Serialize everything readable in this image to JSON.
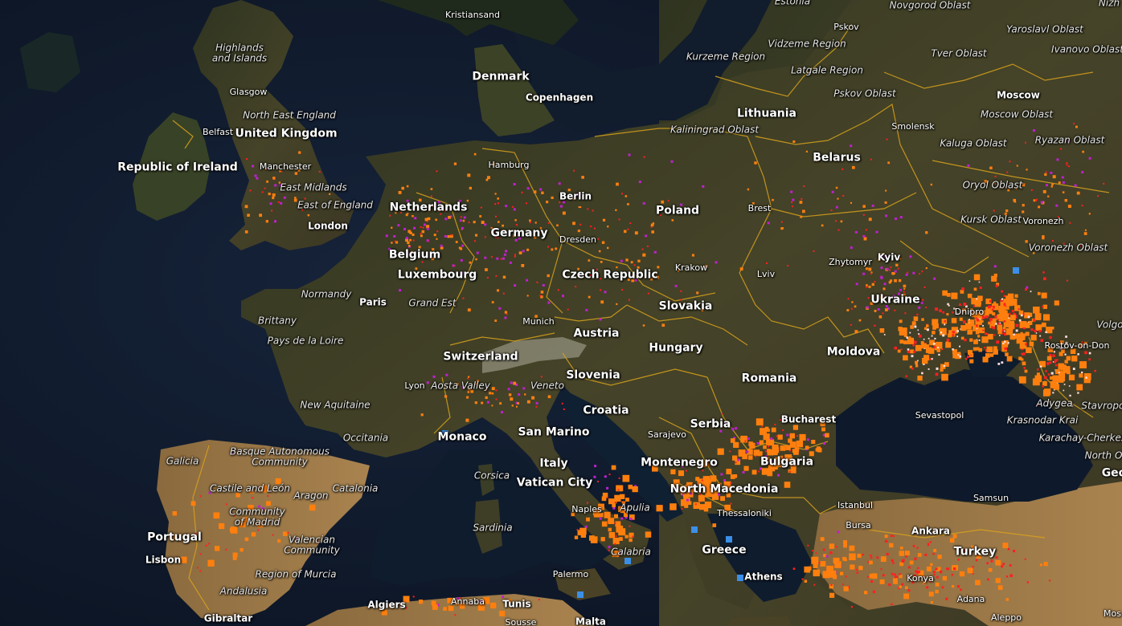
{
  "countries": [
    {
      "name": "Denmark"
    },
    {
      "name": "United Kingdom"
    },
    {
      "name": "Republic of Ireland"
    },
    {
      "name": "Netherlands"
    },
    {
      "name": "Belgium"
    },
    {
      "name": "Luxembourg"
    },
    {
      "name": "Germany"
    },
    {
      "name": "Poland"
    },
    {
      "name": "Lithuania"
    },
    {
      "name": "Belarus"
    },
    {
      "name": "Czech Republic"
    },
    {
      "name": "Slovakia"
    },
    {
      "name": "Austria"
    },
    {
      "name": "Hungary"
    },
    {
      "name": "Switzerland"
    },
    {
      "name": "Slovenia"
    },
    {
      "name": "Croatia"
    },
    {
      "name": "Romania"
    },
    {
      "name": "Moldova"
    },
    {
      "name": "Ukraine"
    },
    {
      "name": "Serbia"
    },
    {
      "name": "Bulgaria"
    },
    {
      "name": "Montenegro"
    },
    {
      "name": "North Macedonia"
    },
    {
      "name": "Greece"
    },
    {
      "name": "Turkey"
    },
    {
      "name": "Italy"
    },
    {
      "name": "Vatican City"
    },
    {
      "name": "San Marino"
    },
    {
      "name": "Monaco"
    },
    {
      "name": "Portugal"
    },
    {
      "name": "Geo"
    }
  ],
  "cities": [
    {
      "name": "Kristiansand"
    },
    {
      "name": "Copenhagen"
    },
    {
      "name": "Glasgow"
    },
    {
      "name": "Belfast"
    },
    {
      "name": "Manchester"
    },
    {
      "name": "London"
    },
    {
      "name": "Hamburg"
    },
    {
      "name": "Berlin"
    },
    {
      "name": "Dresden"
    },
    {
      "name": "Paris"
    },
    {
      "name": "Munich"
    },
    {
      "name": "Krakow"
    },
    {
      "name": "Brest"
    },
    {
      "name": "Lviv"
    },
    {
      "name": "Zhytomyr"
    },
    {
      "name": "Kyiv"
    },
    {
      "name": "Pskov"
    },
    {
      "name": "Smolensk"
    },
    {
      "name": "Moscow"
    },
    {
      "name": "Voronezh"
    },
    {
      "name": "Dnipro"
    },
    {
      "name": "Rostov-on-Don"
    },
    {
      "name": "Sevastopol"
    },
    {
      "name": "Bucharest"
    },
    {
      "name": "Sarajevo"
    },
    {
      "name": "Thessaloniki"
    },
    {
      "name": "Istanbul"
    },
    {
      "name": "Ankara"
    },
    {
      "name": "Bursa"
    },
    {
      "name": "Konya"
    },
    {
      "name": "Adana"
    },
    {
      "name": "Aleppo"
    },
    {
      "name": "Athens"
    },
    {
      "name": "Samsun"
    },
    {
      "name": "Naples"
    },
    {
      "name": "Palermo"
    },
    {
      "name": "Lyon"
    },
    {
      "name": "Lisbon"
    },
    {
      "name": "Gibraltar"
    },
    {
      "name": "Algiers"
    },
    {
      "name": "Annaba"
    },
    {
      "name": "Tunis"
    },
    {
      "name": "Malta"
    },
    {
      "name": "Sousse"
    },
    {
      "name": "Mos"
    }
  ],
  "regions": [
    {
      "name": "Highlands\nand Islands"
    },
    {
      "name": "North East England"
    },
    {
      "name": "East Midlands"
    },
    {
      "name": "East of England"
    },
    {
      "name": "Normandy"
    },
    {
      "name": "Grand Est"
    },
    {
      "name": "Brittany"
    },
    {
      "name": "Pays de la Loire"
    },
    {
      "name": "New Aquitaine"
    },
    {
      "name": "Occitania"
    },
    {
      "name": "Aosta Valley"
    },
    {
      "name": "Veneto"
    },
    {
      "name": "Basque Autonomous\nCommunity"
    },
    {
      "name": "Galicia"
    },
    {
      "name": "Castile and León"
    },
    {
      "name": "Aragon"
    },
    {
      "name": "Catalonia"
    },
    {
      "name": "Community\nof Madrid"
    },
    {
      "name": "Valencian\nCommunity"
    },
    {
      "name": "Region of Murcia"
    },
    {
      "name": "Andalusia"
    },
    {
      "name": "Corsica"
    },
    {
      "name": "Sardinia"
    },
    {
      "name": "Apulia"
    },
    {
      "name": "Calabria"
    },
    {
      "name": "Kurzeme Region"
    },
    {
      "name": "Vidzeme Region"
    },
    {
      "name": "Latgale Region"
    },
    {
      "name": "Pskov Oblast"
    },
    {
      "name": "Kaliningrad Oblast"
    },
    {
      "name": "Novgorod Oblast"
    },
    {
      "name": "Tver Oblast"
    },
    {
      "name": "Yaroslavl Oblast"
    },
    {
      "name": "Ivanovo Oblast"
    },
    {
      "name": "Moscow Oblast"
    },
    {
      "name": "Kaluga Oblast"
    },
    {
      "name": "Ryazan Oblast"
    },
    {
      "name": "Oryol Oblast"
    },
    {
      "name": "Kursk Oblast"
    },
    {
      "name": "Voronezh Oblast"
    },
    {
      "name": "Krasnodar Krai"
    },
    {
      "name": "Karachay-Cherkess"
    },
    {
      "name": "North O"
    },
    {
      "name": "Adygea"
    },
    {
      "name": "Stavropol"
    },
    {
      "name": "Volgo"
    },
    {
      "name": "Estonia"
    },
    {
      "name": "Nizh"
    }
  ],
  "colors": {
    "ocean": "#0f1a2a",
    "land": "#3a3b25",
    "land_arid": "#7a5a34",
    "border": "#d8a21c",
    "marker_orange": "#ff7f0e",
    "marker_red": "#ff2020",
    "marker_magenta": "#c020d0",
    "marker_blue": "#3b8fe8",
    "marker_white": "#ffe0e0"
  }
}
